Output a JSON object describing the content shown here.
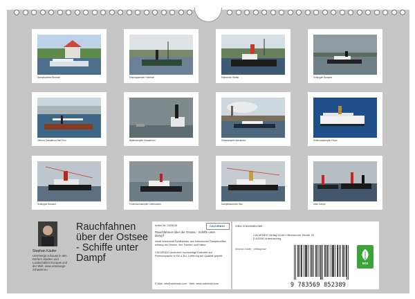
{
  "calendar": {
    "title": "Rauchfahnen über der Ostsee - Schiffe unter Dampf"
  },
  "photos": [
    {
      "caption": "Dampfschiebe Binnhöe"
    },
    {
      "caption": "Eisbergdampfer Hüdrison"
    },
    {
      "caption": "Eisbrecher Stettin"
    },
    {
      "caption": "Schlepper Bussard"
    },
    {
      "caption": "Offenes Dampfboot Reif Frun"
    },
    {
      "caption": "Bäderdampfer Schaarhörn"
    },
    {
      "caption": "Salondampfer Alexandra"
    },
    {
      "caption": "Seitenraddampfer Freya"
    },
    {
      "caption": "Schlepper Bussard"
    },
    {
      "caption": "Feuerlöschdampfer Oberhausen"
    },
    {
      "caption": "Dampfeisbrecher Wal"
    },
    {
      "caption": "unter Dampf"
    }
  ],
  "author": {
    "name": "Stephan Käufer",
    "bio": "Unterwegs zuhause in den Dörfern Städten und Landschaften Europas und der Welt. www.unterwegs-zuhause.eu"
  },
  "info": {
    "article": "Artikel Nr. 2428416",
    "title": "Rauchfahnen über der Ostsee - Schiffe unter Dampf",
    "paragraph1": "Inhalt beschreibt Schiffsbilder aus historischen Dampfschiffen entlang der Ostsee, ihre Fahrten und Häfen.",
    "paragraph2": "CALVENDO produziert hochwertige Kalender auf Premiumpapier in DE & EU. Lieferung auf Qualität geprüft.",
    "contact": "E-Mail: info@calvendo.com · Web: www.calvendo.com"
  },
  "brand": {
    "logo_text": "CALVENDO"
  },
  "back": {
    "isbn": "ISBN 9783569852389",
    "publisher": "CALVENDO Verlag GmbH Ottobrunner Straße 39 D-82008 Unterhaching",
    "publisher_note": "Stephan Käufer · Weltagentur",
    "barcode_digits": "9 783569 852389",
    "eco_label": "eco"
  },
  "colors": {
    "background": "#c6c6c6",
    "card": "#ffffff",
    "eco_green": "#3aa43a"
  }
}
